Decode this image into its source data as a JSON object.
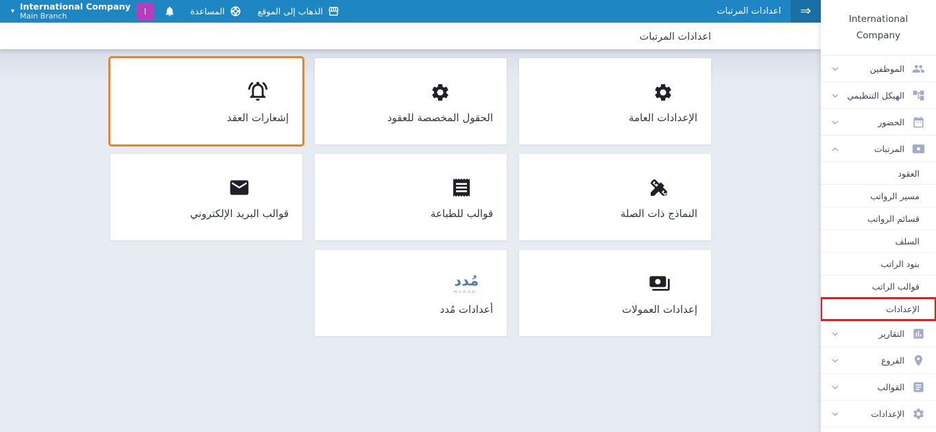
{
  "topbar": {
    "page_title": "اعدادات المرتبات",
    "go_to_site_label": "الذهاب إلى الموقع",
    "help_label": "المساعدة",
    "avatar_letter": "I",
    "company_name": "International Company",
    "branch_name": "Main Branch",
    "toggle_arrow": "⇒",
    "caret": "▾"
  },
  "header": {
    "title": "اعدادات المرتبات"
  },
  "sidebar": {
    "company_name": "International Company",
    "top_items": [
      "الموظفين",
      "الهيكل التنظيمي",
      "الحضور",
      "المرتبات"
    ],
    "salary_submenu": [
      "العقود",
      "مسير الرواتب",
      "قسائم الرواتب",
      "السلف",
      "بنود الراتب",
      "قوالب الراتب",
      "الإعدادات"
    ],
    "bottom_items": [
      "التقارير",
      "الفروع",
      "القوالب",
      "الإعدادات"
    ]
  },
  "cards": [
    {
      "label": "الإعدادات العامة",
      "icon": "gear-icon"
    },
    {
      "label": "الحقول المخصصة للعقود",
      "icon": "gear-icon"
    },
    {
      "label": "إشعارات العقد",
      "icon": "bell-ringing-icon",
      "highlighted": "orange"
    },
    {
      "label": "النماذج ذات الصلة",
      "icon": "design-tools-icon"
    },
    {
      "label": "قوالب للطباعة",
      "icon": "receipt-icon"
    },
    {
      "label": "قوالب البريد الإلكتروني",
      "icon": "email-icon"
    },
    {
      "label": "إعدادات العمولات",
      "icon": "payments-icon"
    },
    {
      "label": "أعدادات مُدد",
      "icon": "mudad-logo",
      "logo_arabic": "مُدد",
      "logo_latin": "MUDAD"
    }
  ],
  "colors": {
    "topbar_blue": "#1f86c4",
    "toggle_blue": "#1a6fa6",
    "avatar_purple": "#b33ebe",
    "sidebar_icon": "#a3abc6",
    "annotation_orange": "#e8832d",
    "annotation_red": "#e01f1f",
    "content_bg": "#e7ebf2"
  }
}
